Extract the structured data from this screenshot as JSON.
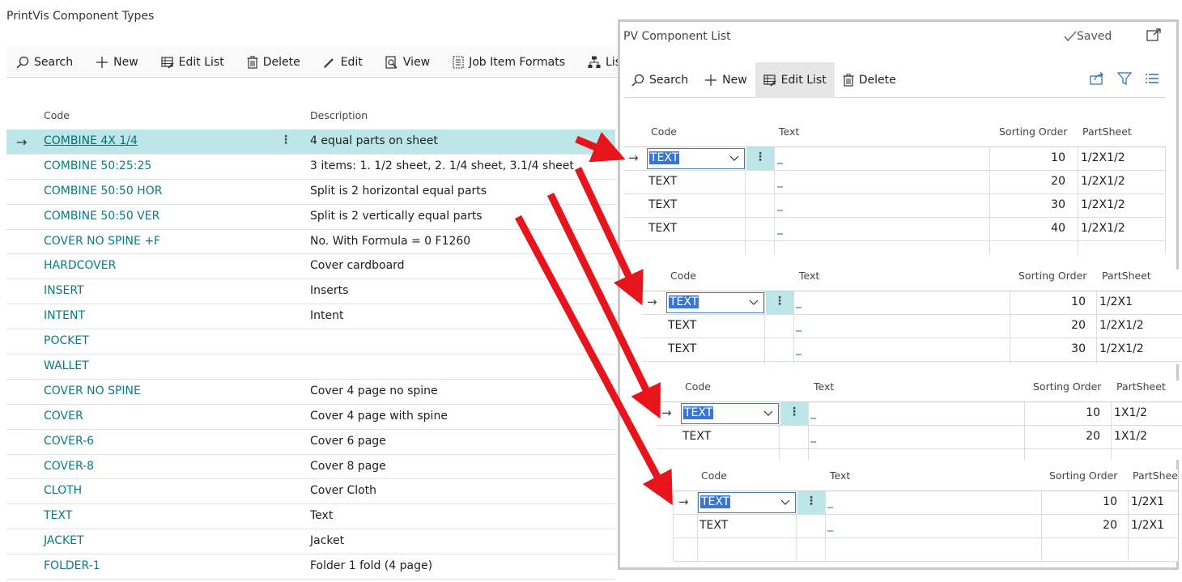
{
  "page": {
    "title": "PrintVis Component Types"
  },
  "toolbar": {
    "search": "Search",
    "new": "New",
    "edit_list": "Edit List",
    "delete": "Delete",
    "edit": "Edit",
    "view": "View",
    "job_item_formats": "Job Item Formats",
    "list_truncated": "Lis"
  },
  "columns": {
    "code": "Code",
    "description": "Description"
  },
  "rows": [
    {
      "code": "COMBINE 4X 1/4",
      "description": "4 equal parts on sheet"
    },
    {
      "code": "COMBINE 50:25:25",
      "description": "3 items: 1. 1/2 sheet, 2. 1/4 sheet, 3.1/4 sheet"
    },
    {
      "code": "COMBINE 50:50 HOR",
      "description": "Split is 2 horizontal equal parts"
    },
    {
      "code": "COMBINE 50:50 VER",
      "description": "Split is 2 vertically equal parts"
    },
    {
      "code": "COVER NO SPINE +F",
      "description": "No. With Formula = 0 F1260"
    },
    {
      "code": "HARDCOVER",
      "description": "Cover cardboard"
    },
    {
      "code": "INSERT",
      "description": "Inserts"
    },
    {
      "code": "INTENT",
      "description": "Intent"
    },
    {
      "code": "POCKET",
      "description": ""
    },
    {
      "code": "WALLET",
      "description": ""
    },
    {
      "code": "COVER NO SPINE",
      "description": "Cover 4 page no spine"
    },
    {
      "code": "COVER",
      "description": "Cover 4 page with spine"
    },
    {
      "code": "COVER-6",
      "description": "Cover 6 page"
    },
    {
      "code": "COVER-8",
      "description": "Cover 8 page"
    },
    {
      "code": "CLOTH",
      "description": "Cover Cloth"
    },
    {
      "code": "TEXT",
      "description": "Text"
    },
    {
      "code": "JACKET",
      "description": "Jacket"
    },
    {
      "code": "FOLDER-1",
      "description": "Folder 1 fold (4 page)"
    }
  ],
  "panel": {
    "title": "PV Component List",
    "saved": "Saved",
    "toolbar": {
      "search": "Search",
      "new": "New",
      "edit_list": "Edit List",
      "delete": "Delete"
    },
    "headers": {
      "code": "Code",
      "text": "Text",
      "sorting_order": "Sorting Order",
      "partsheet": "PartSheet",
      "partsheet_truncated": "PartSheet"
    },
    "lists": [
      {
        "rows": [
          {
            "code": "TEXT",
            "text": "_",
            "order": "10",
            "partsheet": "1/2X1/2"
          },
          {
            "code": "TEXT",
            "text": "_",
            "order": "20",
            "partsheet": "1/2X1/2"
          },
          {
            "code": "TEXT",
            "text": "_",
            "order": "30",
            "partsheet": "1/2X1/2"
          },
          {
            "code": "TEXT",
            "text": "_",
            "order": "40",
            "partsheet": "1/2X1/2"
          }
        ]
      },
      {
        "rows": [
          {
            "code": "TEXT",
            "text": "_",
            "order": "10",
            "partsheet": "1/2X1"
          },
          {
            "code": "TEXT",
            "text": "_",
            "order": "20",
            "partsheet": "1/2X1/2"
          },
          {
            "code": "TEXT",
            "text": "_",
            "order": "30",
            "partsheet": "1/2X1/2"
          }
        ]
      },
      {
        "rows": [
          {
            "code": "TEXT",
            "text": "_",
            "order": "10",
            "partsheet": "1X1/2"
          },
          {
            "code": "TEXT",
            "text": "_",
            "order": "20",
            "partsheet": "1X1/2"
          }
        ]
      },
      {
        "rows": [
          {
            "code": "TEXT",
            "text": "_",
            "order": "10",
            "partsheet": "1/2X1"
          },
          {
            "code": "TEXT",
            "text": "_",
            "order": "20",
            "partsheet": "1/2X1"
          }
        ]
      }
    ]
  },
  "colors": {
    "accent": "#0a7b83",
    "selected_row": "#bde6e8",
    "arrow": "#e8141b",
    "text_highlight": "#3875d7"
  }
}
